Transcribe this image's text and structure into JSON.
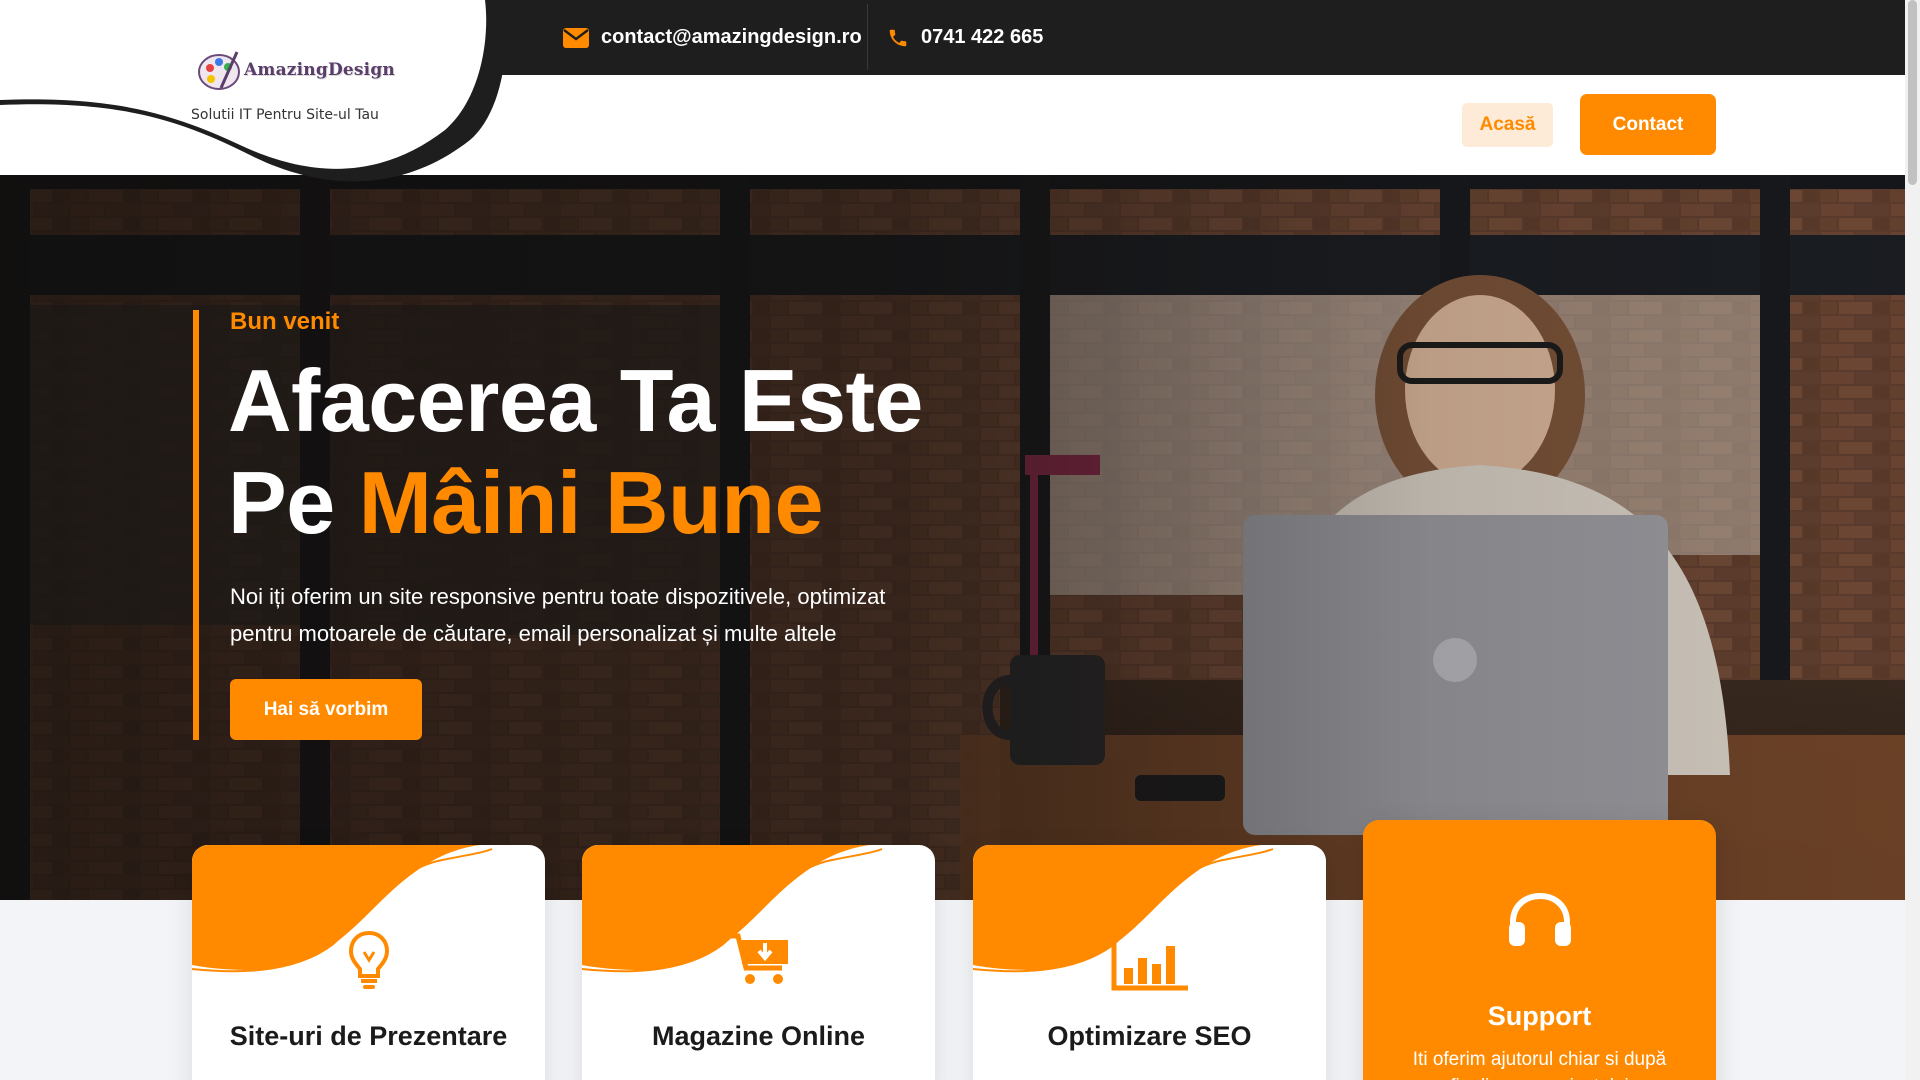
{
  "brand": {
    "logo_text": "AmazingDesign",
    "tagline": "Solutii IT Pentru Site-ul Tau"
  },
  "topbar": {
    "email": "contact@amazingdesign.ro",
    "phone": "0741 422 665"
  },
  "nav": {
    "items": [
      {
        "label": "Acasă"
      },
      {
        "label": "Contact"
      }
    ]
  },
  "hero": {
    "eyebrow": "Bun venit",
    "title_line1": "Afacerea Ta Este",
    "title_line2_prefix": "Pe ",
    "title_line2_highlight": "Mâini Bune",
    "description": "Noi iți oferim un site responsive pentru toate dispozitivele, optimizat pentru motoarele de căutare, email personalizat și multe altele",
    "cta": "Hai să vorbim"
  },
  "services": [
    {
      "title": "Site-uri de Prezentare",
      "icon": "lightbulb-icon"
    },
    {
      "title": "Magazine Online",
      "icon": "cart-download-icon"
    },
    {
      "title": "Optimizare SEO",
      "icon": "bar-chart-icon"
    },
    {
      "title": "Support",
      "icon": "headset-icon",
      "description": "Iti oferim ajutorul chiar si după finalizarea proiectului"
    }
  ],
  "colors": {
    "accent": "#ff8a00",
    "dark": "#1e1e1f",
    "text": "#1b1b1b"
  }
}
